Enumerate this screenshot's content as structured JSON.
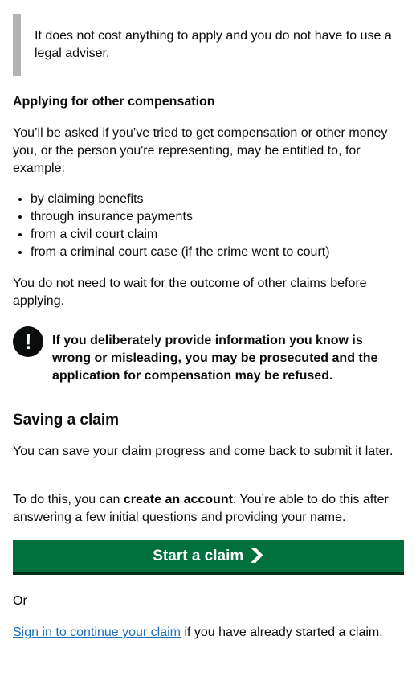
{
  "inset": {
    "text": "It does not cost anything to apply and you do not have to use a legal adviser."
  },
  "other_compensation": {
    "heading": "Applying for other compensation",
    "intro": "You’ll be asked if you’ve tried to get compensation or other money you, or the person you're representing, may be entitled to, for example:",
    "bullets": [
      "by claiming benefits",
      "through insurance payments",
      "from a civil court claim",
      "from a criminal court case (if the crime went to court)"
    ],
    "no_wait": "You do not need to wait for the outcome of other claims before applying."
  },
  "warning": {
    "icon": "!",
    "text": "If you deliberately provide information you know is wrong or misleading, you may be prosecuted and the application for compensation may be refused."
  },
  "saving": {
    "heading": "Saving a claim",
    "para1": "You can save your claim progress and come back to submit it later.",
    "para2_prefix": "To do this, you can ",
    "para2_bold": "create an account",
    "para2_suffix": ". You’re able to do this after answering a few initial questions and providing your name."
  },
  "start_button": {
    "label": "Start a claim",
    "color": "#00703c"
  },
  "or_text": "Or",
  "sign_in": {
    "link_text": "Sign in to continue your claim",
    "suffix": " if you have already started a claim."
  }
}
